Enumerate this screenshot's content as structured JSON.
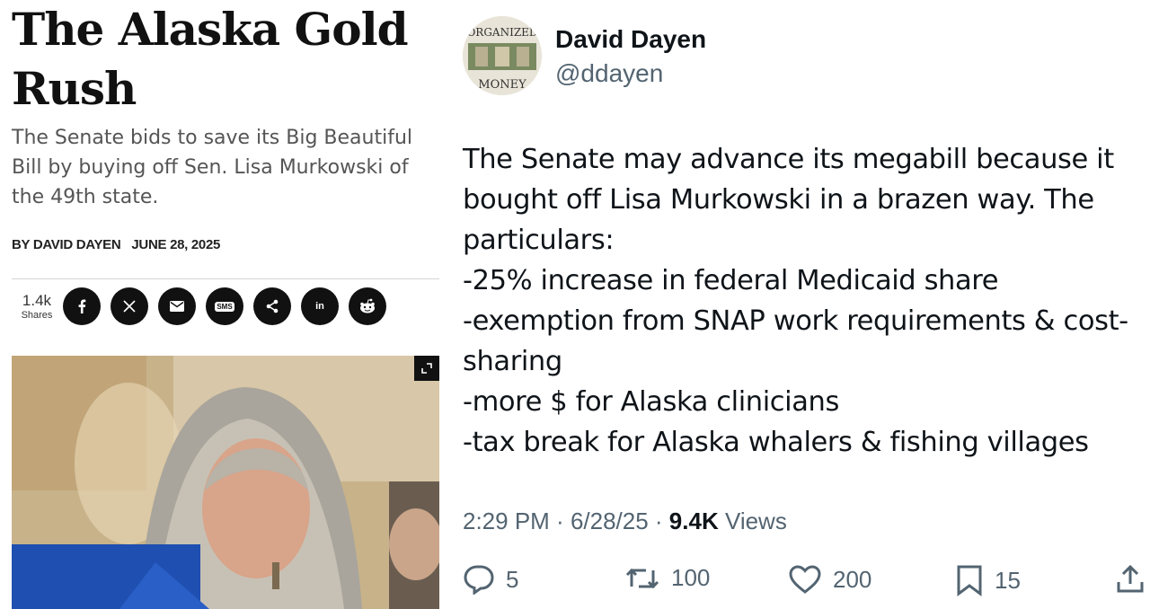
{
  "article": {
    "headline": "The Alaska Gold Rush",
    "dek": "The Senate bids to save its Big Beautiful Bill by buying off Sen. Lisa Murkowski of the 49th state.",
    "author": "BY DAVID DAYEN",
    "date": "JUNE 28, 2025",
    "shares_count": "1.4k",
    "shares_label": "Shares",
    "share_buttons": [
      "facebook-icon",
      "x-icon",
      "email-icon",
      "sms-icon",
      "share-icon",
      "linkedin-icon",
      "reddit-icon"
    ],
    "sms_text": "SMS",
    "linkedin_text": "in"
  },
  "tweet": {
    "name": "David Dayen",
    "handle": "@ddayen",
    "avatar_top": "ORGANIZED",
    "avatar_bottom": "MONEY",
    "lines": [
      "The Senate may advance its megabill because it",
      "bought off Lisa Murkowski in a brazen way. The",
      "particulars:",
      "-25% increase in federal Medicaid share",
      "-exemption from SNAP work requirements & cost-",
      "sharing",
      "-more $ for Alaska clinicians",
      "-tax break for Alaska whalers & fishing villages"
    ],
    "time": "2:29 PM",
    "date": "6/28/25",
    "views_count": "9.4K",
    "views_label": "Views",
    "replies": "5",
    "reposts": "100",
    "likes": "200",
    "bookmarks": "15"
  }
}
